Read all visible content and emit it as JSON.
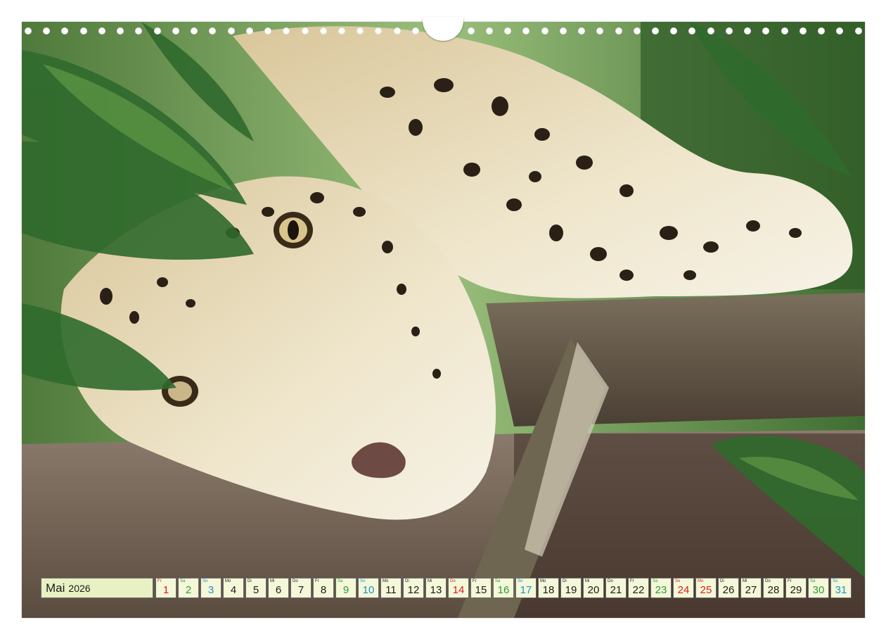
{
  "photo": {
    "subject": "jaguar-resting-on-wooden-plank"
  },
  "calendar": {
    "month": "Mai",
    "year": "2026",
    "colors": {
      "weekday": "#1a1a1a",
      "saturday": "#2e9a3a",
      "sunday": "#1c8fd0",
      "holiday": "#d81e1e",
      "month_bg": "#e8f1c4",
      "day_bg": "#f4f8d8"
    },
    "days": [
      {
        "wd": "Fr",
        "num": "1",
        "type": "holiday"
      },
      {
        "wd": "Sa",
        "num": "2",
        "type": "saturday"
      },
      {
        "wd": "So",
        "num": "3",
        "type": "sunday"
      },
      {
        "wd": "Mo",
        "num": "4",
        "type": "weekday"
      },
      {
        "wd": "Di",
        "num": "5",
        "type": "weekday"
      },
      {
        "wd": "Mi",
        "num": "6",
        "type": "weekday"
      },
      {
        "wd": "Do",
        "num": "7",
        "type": "weekday"
      },
      {
        "wd": "Fr",
        "num": "8",
        "type": "weekday"
      },
      {
        "wd": "Sa",
        "num": "9",
        "type": "saturday"
      },
      {
        "wd": "So",
        "num": "10",
        "type": "sunday"
      },
      {
        "wd": "Mo",
        "num": "11",
        "type": "weekday"
      },
      {
        "wd": "Di",
        "num": "12",
        "type": "weekday"
      },
      {
        "wd": "Mi",
        "num": "13",
        "type": "weekday"
      },
      {
        "wd": "Do",
        "num": "14",
        "type": "holiday"
      },
      {
        "wd": "Fr",
        "num": "15",
        "type": "weekday"
      },
      {
        "wd": "Sa",
        "num": "16",
        "type": "saturday"
      },
      {
        "wd": "So",
        "num": "17",
        "type": "sunday"
      },
      {
        "wd": "Mo",
        "num": "18",
        "type": "weekday"
      },
      {
        "wd": "Di",
        "num": "19",
        "type": "weekday"
      },
      {
        "wd": "Mi",
        "num": "20",
        "type": "weekday"
      },
      {
        "wd": "Do",
        "num": "21",
        "type": "weekday"
      },
      {
        "wd": "Fr",
        "num": "22",
        "type": "weekday"
      },
      {
        "wd": "Sa",
        "num": "23",
        "type": "saturday"
      },
      {
        "wd": "So",
        "num": "24",
        "type": "holiday"
      },
      {
        "wd": "Mo",
        "num": "25",
        "type": "holiday"
      },
      {
        "wd": "Di",
        "num": "26",
        "type": "weekday"
      },
      {
        "wd": "Mi",
        "num": "27",
        "type": "weekday"
      },
      {
        "wd": "Do",
        "num": "28",
        "type": "weekday"
      },
      {
        "wd": "Fr",
        "num": "29",
        "type": "weekday"
      },
      {
        "wd": "Sa",
        "num": "30",
        "type": "saturday"
      },
      {
        "wd": "So",
        "num": "31",
        "type": "sunday"
      }
    ]
  }
}
